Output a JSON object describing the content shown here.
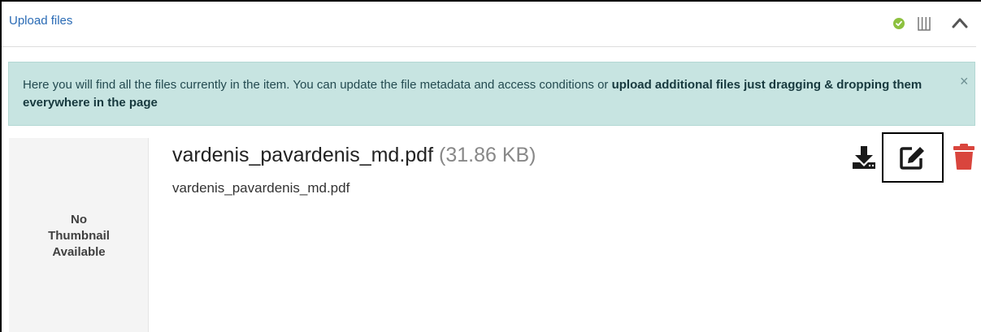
{
  "header": {
    "upload_link": "Upload files"
  },
  "alert": {
    "text_plain": "Here you will find all the files currently in the item. You can update the file metadata and access conditions or ",
    "text_bold": "upload additional files just dragging & dropping them everywhere in the page",
    "close_symbol": "×"
  },
  "file": {
    "thumbnail_line1": "No",
    "thumbnail_line2": "Thumbnail",
    "thumbnail_line3": "Available",
    "name": "vardenis_pavardenis_md.pdf",
    "size": "(31.86 KB)",
    "subtitle": "vardenis_pavardenis_md.pdf"
  },
  "icons": {
    "status": "check-circle-icon",
    "columns": "columns-icon",
    "collapse": "chevron-up-icon",
    "download": "download-icon",
    "edit": "edit-icon",
    "delete": "trash-icon"
  },
  "colors": {
    "link": "#2a6bb5",
    "alert_bg": "#c7e4e1",
    "status_ok": "#8dc13f",
    "delete": "#d9453d"
  }
}
